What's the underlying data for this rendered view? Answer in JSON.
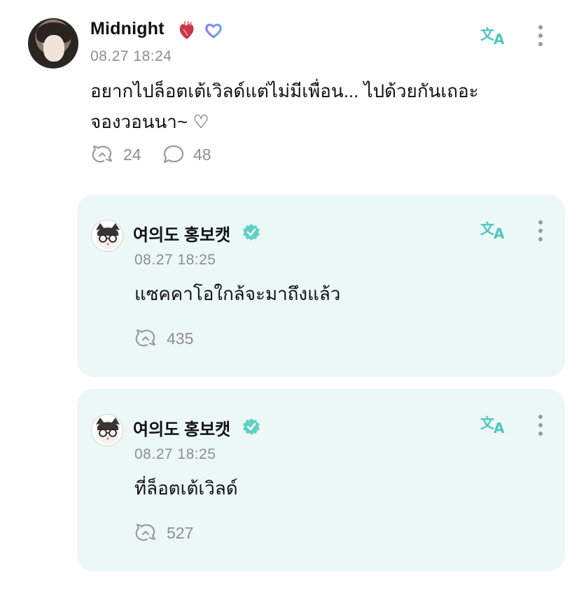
{
  "post": {
    "author": "Midnight",
    "timestamp": "08.27 18:24",
    "text": "อยากไปล็อตเต้เวิลด์แต่ไม่มีเพื่อน... ไปด้วยกันเถอะ\nจองวอนนา~ ♡",
    "repost_count": "24",
    "comment_count": "48",
    "icons": [
      "anatomical-heart-icon",
      "heart-outline-badge-icon",
      "translate-icon",
      "more-vertical-icon",
      "repost-icon",
      "comment-icon"
    ]
  },
  "replies": [
    {
      "author": "여의도 홍보캣",
      "timestamp": "08.27 18:25",
      "text": "แซคคาโอใกล้จะมาถึงแล้ว",
      "repost_count": "435"
    },
    {
      "author": "여의도 홍보캣",
      "timestamp": "08.27 18:25",
      "text": "ที่ล็อตเต้เวิลด์",
      "repost_count": "527"
    }
  ],
  "colors": {
    "accent_teal": "#4fc6bd",
    "reply_bg": "#ecf8f6",
    "muted_text": "#8e8e8e",
    "badge_purple": "#8a7cf6"
  }
}
